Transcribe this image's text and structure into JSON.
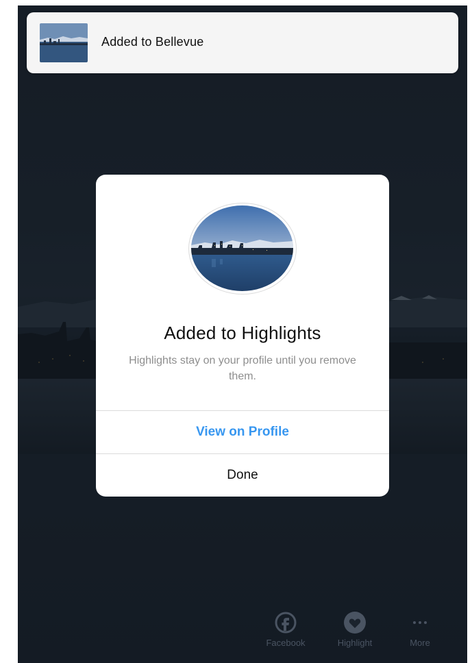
{
  "toast": {
    "text": "Added to Bellevue"
  },
  "dialog": {
    "title": "Added to Highlights",
    "message": "Highlights stay on your profile until you remove them.",
    "primary_button": "View on Profile",
    "secondary_button": "Done"
  },
  "share_bar": {
    "items": [
      {
        "label": "Facebook",
        "icon": "facebook-icon"
      },
      {
        "label": "Highlight",
        "icon": "heart-icon"
      },
      {
        "label": "More",
        "icon": "more-icon"
      }
    ]
  },
  "colors": {
    "link_blue": "#3897f0",
    "dialog_bg": "#ffffff",
    "backdrop": "#1d2530",
    "secondary_text": "#8e8e8e"
  }
}
